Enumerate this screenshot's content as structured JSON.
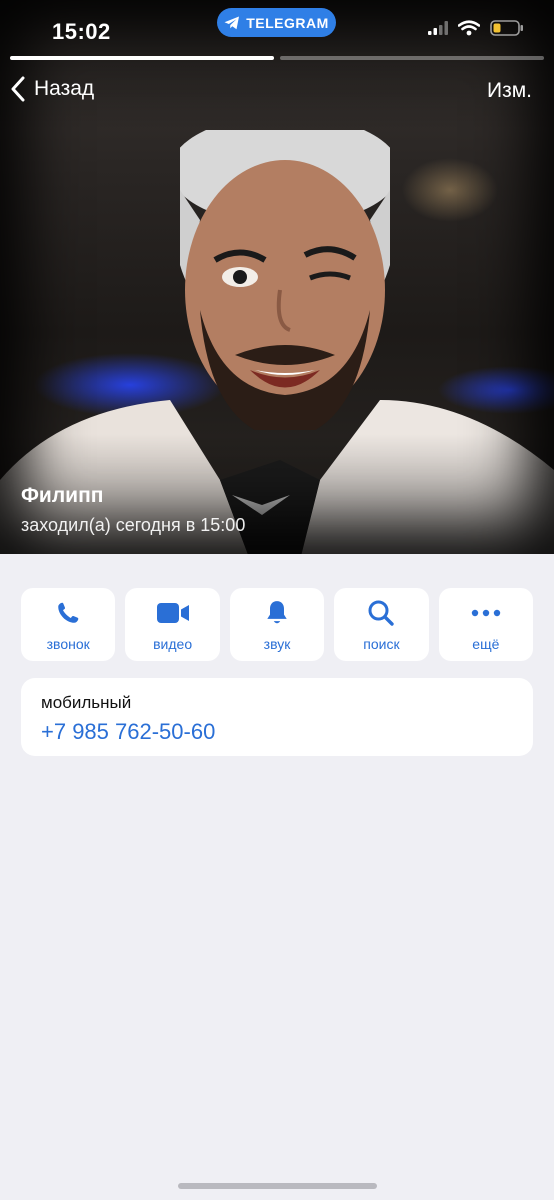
{
  "status_bar": {
    "time": "15:02",
    "pill_label": "TELEGRAM"
  },
  "nav": {
    "back_label": "Назад",
    "edit_label": "Изм."
  },
  "story": {
    "segments": 2,
    "active_index": 0
  },
  "contact": {
    "name": "Филипп",
    "last_seen": "заходил(а) сегодня в 15:00"
  },
  "actions": [
    {
      "label": "звонок",
      "icon": "phone-icon"
    },
    {
      "label": "видео",
      "icon": "video-camera-icon"
    },
    {
      "label": "звук",
      "icon": "bell-icon"
    },
    {
      "label": "поиск",
      "icon": "search-icon"
    },
    {
      "label": "ещё",
      "icon": "more-dots-icon"
    }
  ],
  "phone": {
    "label": "мобильный",
    "number": "+7 985 762-50-60"
  },
  "colors": {
    "accent": "#2a6fd6",
    "pill": "#2f7fe6",
    "background": "#efeff4"
  }
}
